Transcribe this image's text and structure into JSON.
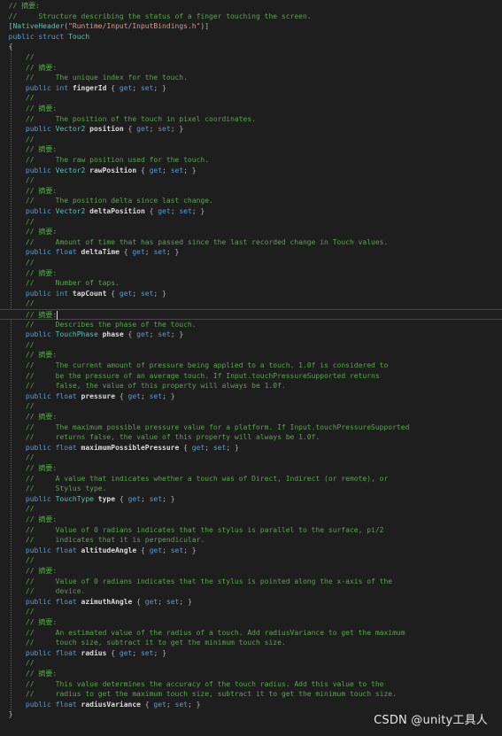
{
  "editor": {
    "lines": [
      [
        [
          "comment",
          "// 摘要:"
        ]
      ],
      [
        [
          "comment",
          "//     Structure describing the status of a finger touching the screen."
        ]
      ],
      [
        [
          "punct",
          "["
        ],
        [
          "type",
          "NativeHeader"
        ],
        [
          "punct",
          "("
        ],
        [
          "string",
          "\"Runtime/Input/InputBindings.h\""
        ],
        [
          "punct",
          ")]"
        ]
      ],
      [
        [
          "keyword",
          "public "
        ],
        [
          "keyword",
          "struct "
        ],
        [
          "type",
          "Touch"
        ]
      ],
      [
        [
          "punct",
          "{"
        ]
      ],
      [
        [
          "comment",
          "    //"
        ]
      ],
      [
        [
          "comment",
          "    // 摘要:"
        ]
      ],
      [
        [
          "comment",
          "    //     The unique index for the touch."
        ]
      ],
      [
        [
          "keyword",
          "    public "
        ],
        [
          "keyword",
          "int "
        ],
        [
          "bold",
          "fingerId"
        ],
        [
          "punct",
          " { "
        ],
        [
          "keyword",
          "get"
        ],
        [
          "punct",
          "; "
        ],
        [
          "keyword",
          "set"
        ],
        [
          "punct",
          "; }"
        ]
      ],
      [
        [
          "comment",
          "    //"
        ]
      ],
      [
        [
          "comment",
          "    // 摘要:"
        ]
      ],
      [
        [
          "comment",
          "    //     The position of the touch in pixel coordinates."
        ]
      ],
      [
        [
          "keyword",
          "    public "
        ],
        [
          "type",
          "Vector2 "
        ],
        [
          "bold",
          "position"
        ],
        [
          "punct",
          " { "
        ],
        [
          "keyword",
          "get"
        ],
        [
          "punct",
          "; "
        ],
        [
          "keyword",
          "set"
        ],
        [
          "punct",
          "; }"
        ]
      ],
      [
        [
          "comment",
          "    //"
        ]
      ],
      [
        [
          "comment",
          "    // 摘要:"
        ]
      ],
      [
        [
          "comment",
          "    //     The raw position used for the touch."
        ]
      ],
      [
        [
          "keyword",
          "    public "
        ],
        [
          "type",
          "Vector2 "
        ],
        [
          "bold",
          "rawPosition"
        ],
        [
          "punct",
          " { "
        ],
        [
          "keyword",
          "get"
        ],
        [
          "punct",
          "; "
        ],
        [
          "keyword",
          "set"
        ],
        [
          "punct",
          "; }"
        ]
      ],
      [
        [
          "comment",
          "    //"
        ]
      ],
      [
        [
          "comment",
          "    // 摘要:"
        ]
      ],
      [
        [
          "comment",
          "    //     The position delta since last change."
        ]
      ],
      [
        [
          "keyword",
          "    public "
        ],
        [
          "type",
          "Vector2 "
        ],
        [
          "bold",
          "deltaPosition"
        ],
        [
          "punct",
          " { "
        ],
        [
          "keyword",
          "get"
        ],
        [
          "punct",
          "; "
        ],
        [
          "keyword",
          "set"
        ],
        [
          "punct",
          "; }"
        ]
      ],
      [
        [
          "comment",
          "    //"
        ]
      ],
      [
        [
          "comment",
          "    // 摘要:"
        ]
      ],
      [
        [
          "comment",
          "    //     Amount of time that has passed since the last recorded change in Touch values."
        ]
      ],
      [
        [
          "keyword",
          "    public "
        ],
        [
          "keyword",
          "float "
        ],
        [
          "bold",
          "deltaTime"
        ],
        [
          "punct",
          " { "
        ],
        [
          "keyword",
          "get"
        ],
        [
          "punct",
          "; "
        ],
        [
          "keyword",
          "set"
        ],
        [
          "punct",
          "; }"
        ]
      ],
      [
        [
          "comment",
          "    //"
        ]
      ],
      [
        [
          "comment",
          "    // 摘要:"
        ]
      ],
      [
        [
          "comment",
          "    //     Number of taps."
        ]
      ],
      [
        [
          "keyword",
          "    public "
        ],
        [
          "keyword",
          "int "
        ],
        [
          "bold",
          "tapCount"
        ],
        [
          "punct",
          " { "
        ],
        [
          "keyword",
          "get"
        ],
        [
          "punct",
          "; "
        ],
        [
          "keyword",
          "set"
        ],
        [
          "punct",
          "; }"
        ]
      ],
      [
        [
          "comment",
          "    //"
        ]
      ],
      [
        [
          "comment",
          "    // 摘要:"
        ],
        [
          "caret",
          ""
        ]
      ],
      [
        [
          "comment",
          "    //     Describes the phase of the touch."
        ]
      ],
      [
        [
          "keyword",
          "    public "
        ],
        [
          "type",
          "TouchPhase "
        ],
        [
          "bold",
          "phase"
        ],
        [
          "punct",
          " { "
        ],
        [
          "keyword",
          "get"
        ],
        [
          "punct",
          "; "
        ],
        [
          "keyword",
          "set"
        ],
        [
          "punct",
          "; }"
        ]
      ],
      [
        [
          "comment",
          "    //"
        ]
      ],
      [
        [
          "comment",
          "    // 摘要:"
        ]
      ],
      [
        [
          "comment",
          "    //     The current amount of pressure being applied to a touch. 1.0f is considered to"
        ]
      ],
      [
        [
          "comment",
          "    //     be the pressure of an average touch. If Input.touchPressureSupported returns"
        ]
      ],
      [
        [
          "comment",
          "    //     false, the value of this property will always be 1.0f."
        ]
      ],
      [
        [
          "keyword",
          "    public "
        ],
        [
          "keyword",
          "float "
        ],
        [
          "bold",
          "pressure"
        ],
        [
          "punct",
          " { "
        ],
        [
          "keyword",
          "get"
        ],
        [
          "punct",
          "; "
        ],
        [
          "keyword",
          "set"
        ],
        [
          "punct",
          "; }"
        ]
      ],
      [
        [
          "comment",
          "    //"
        ]
      ],
      [
        [
          "comment",
          "    // 摘要:"
        ]
      ],
      [
        [
          "comment",
          "    //     The maximum possible pressure value for a platform. If Input.touchPressureSupported"
        ]
      ],
      [
        [
          "comment",
          "    //     returns false, the value of this property will always be 1.0f."
        ]
      ],
      [
        [
          "keyword",
          "    public "
        ],
        [
          "keyword",
          "float "
        ],
        [
          "bold",
          "maximumPossiblePressure"
        ],
        [
          "punct",
          " { "
        ],
        [
          "keyword",
          "get"
        ],
        [
          "punct",
          "; "
        ],
        [
          "keyword",
          "set"
        ],
        [
          "punct",
          "; }"
        ]
      ],
      [
        [
          "comment",
          "    //"
        ]
      ],
      [
        [
          "comment",
          "    // 摘要:"
        ]
      ],
      [
        [
          "comment",
          "    //     A value that indicates whether a touch was of Direct, Indirect (or remote), or"
        ]
      ],
      [
        [
          "comment",
          "    //     Stylus type."
        ]
      ],
      [
        [
          "keyword",
          "    public "
        ],
        [
          "type",
          "TouchType "
        ],
        [
          "bold",
          "type"
        ],
        [
          "punct",
          " { "
        ],
        [
          "keyword",
          "get"
        ],
        [
          "punct",
          "; "
        ],
        [
          "keyword",
          "set"
        ],
        [
          "punct",
          "; }"
        ]
      ],
      [
        [
          "comment",
          "    //"
        ]
      ],
      [
        [
          "comment",
          "    // 摘要:"
        ]
      ],
      [
        [
          "comment",
          "    //     Value of 0 radians indicates that the stylus is parallel to the surface, pi/2"
        ]
      ],
      [
        [
          "comment",
          "    //     indicates that it is perpendicular."
        ]
      ],
      [
        [
          "keyword",
          "    public "
        ],
        [
          "keyword",
          "float "
        ],
        [
          "bold",
          "altitudeAngle"
        ],
        [
          "punct",
          " { "
        ],
        [
          "keyword",
          "get"
        ],
        [
          "punct",
          "; "
        ],
        [
          "keyword",
          "set"
        ],
        [
          "punct",
          "; }"
        ]
      ],
      [
        [
          "comment",
          "    //"
        ]
      ],
      [
        [
          "comment",
          "    // 摘要:"
        ]
      ],
      [
        [
          "comment",
          "    //     Value of 0 radians indicates that the stylus is pointed along the x-axis of the"
        ]
      ],
      [
        [
          "comment",
          "    //     device."
        ]
      ],
      [
        [
          "keyword",
          "    public "
        ],
        [
          "keyword",
          "float "
        ],
        [
          "bold",
          "azimuthAngle"
        ],
        [
          "punct",
          " { "
        ],
        [
          "keyword",
          "get"
        ],
        [
          "punct",
          "; "
        ],
        [
          "keyword",
          "set"
        ],
        [
          "punct",
          "; }"
        ]
      ],
      [
        [
          "comment",
          "    //"
        ]
      ],
      [
        [
          "comment",
          "    // 摘要:"
        ]
      ],
      [
        [
          "comment",
          "    //     An estimated value of the radius of a touch. Add radiusVariance to get the maximum"
        ]
      ],
      [
        [
          "comment",
          "    //     touch size, subtract it to get the minimum touch size."
        ]
      ],
      [
        [
          "keyword",
          "    public "
        ],
        [
          "keyword",
          "float "
        ],
        [
          "bold",
          "radius"
        ],
        [
          "punct",
          " { "
        ],
        [
          "keyword",
          "get"
        ],
        [
          "punct",
          "; "
        ],
        [
          "keyword",
          "set"
        ],
        [
          "punct",
          "; }"
        ]
      ],
      [
        [
          "comment",
          "    //"
        ]
      ],
      [
        [
          "comment",
          "    // 摘要:"
        ]
      ],
      [
        [
          "comment",
          "    //     This value determines the accuracy of the touch radius. Add this value to the"
        ]
      ],
      [
        [
          "comment",
          "    //     radius to get the maximum touch size, subtract it to get the minimum touch size."
        ]
      ],
      [
        [
          "keyword",
          "    public "
        ],
        [
          "keyword",
          "float "
        ],
        [
          "bold",
          "radiusVariance"
        ],
        [
          "punct",
          " { "
        ],
        [
          "keyword",
          "get"
        ],
        [
          "punct",
          "; "
        ],
        [
          "keyword",
          "set"
        ],
        [
          "punct",
          "; }"
        ]
      ],
      [
        [
          "punct",
          "}"
        ]
      ]
    ],
    "current_line": 30
  },
  "watermark": "CSDN @unity工具人"
}
